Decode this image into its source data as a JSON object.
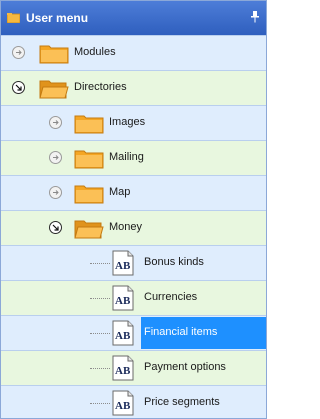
{
  "header": {
    "title": "User menu",
    "icon": "folder-icon",
    "pin_icon": "pin-icon"
  },
  "tree": {
    "modules": {
      "label": "Modules",
      "state": "collapsed"
    },
    "directories": {
      "label": "Directories",
      "state": "expanded"
    },
    "images": {
      "label": "Images",
      "state": "collapsed"
    },
    "mailing": {
      "label": "Mailing",
      "state": "collapsed"
    },
    "map": {
      "label": "Map",
      "state": "collapsed"
    },
    "money": {
      "label": "Money",
      "state": "expanded"
    },
    "bonus_kinds": {
      "label": "Bonus kinds"
    },
    "currencies": {
      "label": "Currencies"
    },
    "financial_items": {
      "label": "Financial items",
      "selected": true
    },
    "payment_options": {
      "label": "Payment options"
    },
    "price_segments": {
      "label": "Price segments"
    }
  },
  "colors": {
    "header": "#3a68c8",
    "selection": "#1e90ff",
    "row_blue": "#dfedfd",
    "row_green": "#e8f7df"
  }
}
